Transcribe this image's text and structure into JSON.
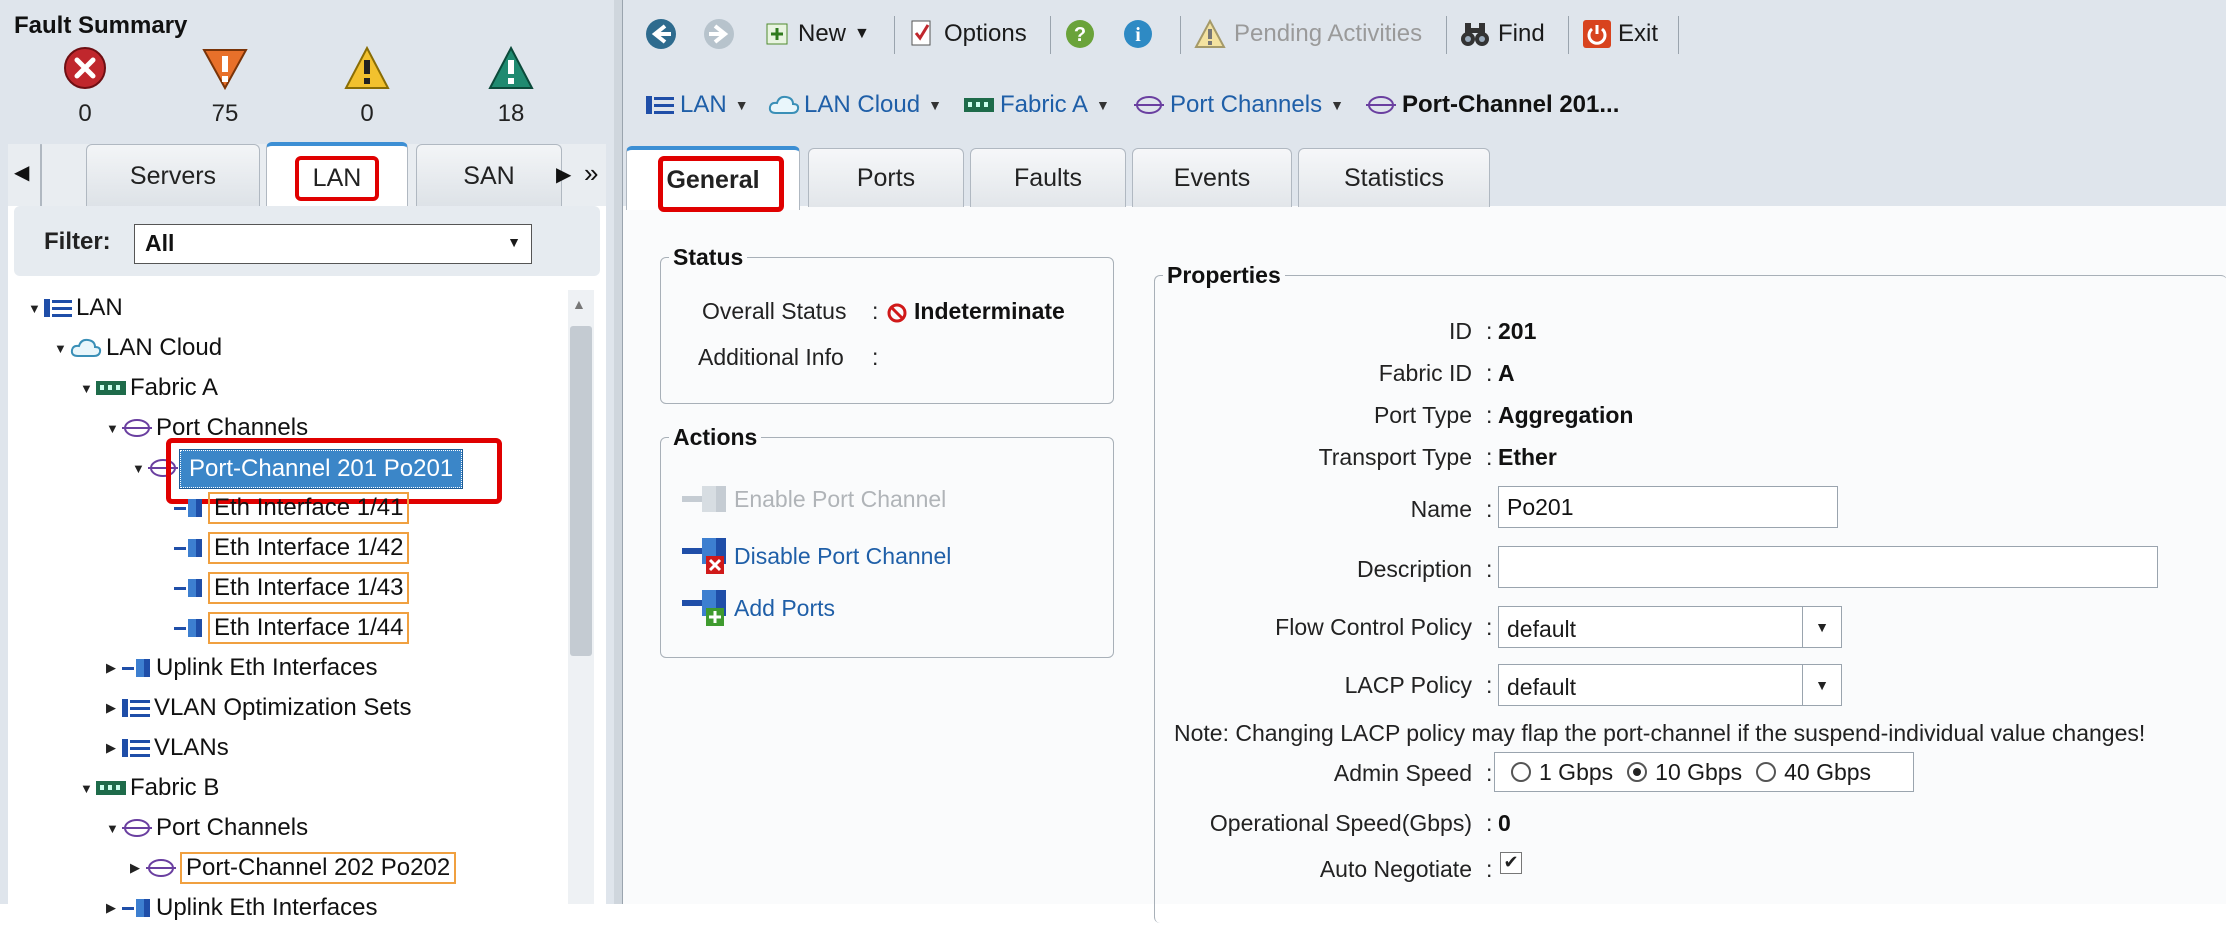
{
  "fault_summary": {
    "title": "Fault Summary",
    "items": [
      {
        "icon": "critical-fault-icon",
        "count": "0",
        "color": "#c0272d"
      },
      {
        "icon": "major-fault-icon",
        "count": "75",
        "color": "#e8702a"
      },
      {
        "icon": "minor-fault-icon",
        "count": "0",
        "color": "#f2c12e"
      },
      {
        "icon": "warning-fault-icon",
        "count": "18",
        "color": "#1f8a70"
      }
    ]
  },
  "left_tabs": {
    "servers": "Servers",
    "lan": "LAN",
    "san": "SAN"
  },
  "filter": {
    "label": "Filter:",
    "value": "All"
  },
  "tree": {
    "lan": "LAN",
    "lan_cloud": "LAN Cloud",
    "fabric_a": "Fabric A",
    "port_channels_a": "Port Channels",
    "pc201": "Port-Channel 201 Po201",
    "eth41": "Eth Interface 1/41",
    "eth42": "Eth Interface 1/42",
    "eth43": "Eth Interface 1/43",
    "eth44": "Eth Interface 1/44",
    "uplink": "Uplink Eth Interfaces",
    "vlan_opt": "VLAN Optimization Sets",
    "vlans": "VLANs",
    "fabric_b": "Fabric B",
    "port_channels_b": "Port Channels",
    "pc202": "Port-Channel 202 Po202",
    "uplink_b": "Uplink Eth Interfaces"
  },
  "toolbar": {
    "new": "New",
    "options": "Options",
    "pending": "Pending Activities",
    "find": "Find",
    "exit": "Exit"
  },
  "breadcrumb": {
    "lan": "LAN",
    "lan_cloud": "LAN Cloud",
    "fabric_a": "Fabric A",
    "port_channels": "Port Channels",
    "current": "Port-Channel 201..."
  },
  "right_tabs": {
    "general": "General",
    "ports": "Ports",
    "faults": "Faults",
    "events": "Events",
    "statistics": "Statistics"
  },
  "status": {
    "legend": "Status",
    "overall_label": "Overall Status",
    "overall_value": "Indeterminate",
    "additional_label": "Additional Info",
    "colon": ":"
  },
  "actions": {
    "legend": "Actions",
    "enable": "Enable Port Channel",
    "disable": "Disable Port Channel",
    "add_ports": "Add Ports"
  },
  "properties": {
    "legend": "Properties",
    "id_label": "ID",
    "id_value": "201",
    "fabric_label": "Fabric ID",
    "fabric_value": "A",
    "port_type_label": "Port Type",
    "port_type_value": "Aggregation",
    "transport_label": "Transport Type",
    "transport_value": "Ether",
    "name_label": "Name",
    "name_value": "Po201",
    "description_label": "Description",
    "description_value": "",
    "flow_label": "Flow Control Policy",
    "flow_value": "default",
    "lacp_label": "LACP Policy",
    "lacp_value": "default",
    "note": "Note: Changing LACP policy may flap the port-channel if the suspend-individual value changes!",
    "admin_speed_label": "Admin Speed",
    "speeds": [
      "1 Gbps",
      "10 Gbps",
      "40 Gbps"
    ],
    "speed_selected": "10 Gbps",
    "op_speed_label": "Operational Speed(Gbps)",
    "op_speed_value": "0",
    "auto_neg_label": "Auto Negotiate",
    "auto_neg_checked": true,
    "colon": ":"
  }
}
